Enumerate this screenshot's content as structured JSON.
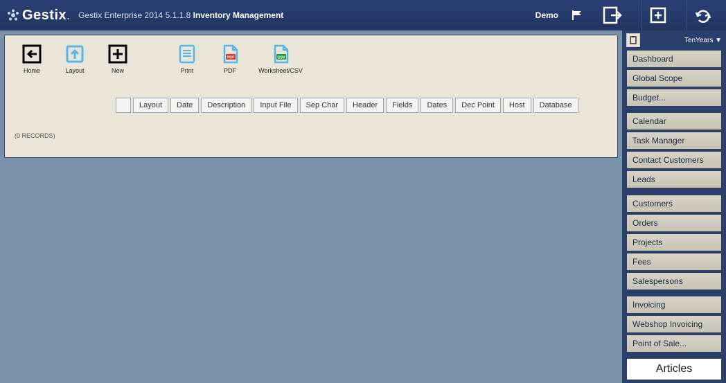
{
  "header": {
    "brand": "Gestix",
    "app_line_prefix": "Gestix Enterprise 2014 5.1.1.8",
    "module": "Inventory Management",
    "demo_label": "Demo"
  },
  "toolbar_top": [
    {
      "id": "home",
      "label": "Home"
    },
    {
      "id": "layout",
      "label": "Layout"
    },
    {
      "id": "new",
      "label": "New"
    },
    {
      "id": "print",
      "label": "Print"
    },
    {
      "id": "pdf",
      "label": "PDF"
    },
    {
      "id": "csv",
      "label": "Worksheet/CSV"
    }
  ],
  "columns": [
    "Layout",
    "Date",
    "Description",
    "Input File",
    "Sep Char",
    "Header",
    "Fields",
    "Dates",
    "Dec Point",
    "Host",
    "Database"
  ],
  "list": {
    "record_count_label": "(0 RECORDS)"
  },
  "sidebar": {
    "period_label": "TenYears ▼",
    "groups": [
      [
        "Dashboard",
        "Global Scope",
        "Budget..."
      ],
      [
        "Calendar",
        "Task Manager",
        "Contact Customers",
        "Leads"
      ],
      [
        "Customers",
        "Orders",
        "Projects",
        "Fees",
        "Salespersons"
      ],
      [
        "Invoicing",
        "Webshop Invoicing",
        "Point of Sale..."
      ]
    ],
    "highlight": "Articles"
  }
}
